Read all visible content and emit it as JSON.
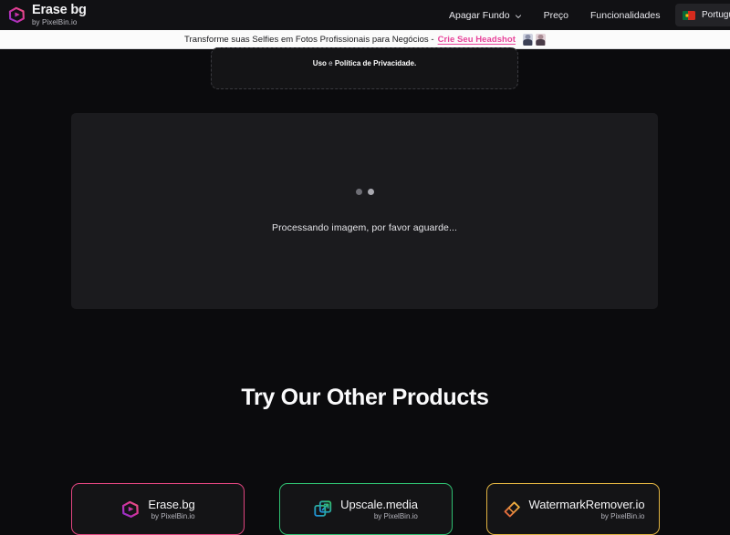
{
  "header": {
    "logo": {
      "title": "Erase bg",
      "subtitle": "by PixelBin.io",
      "icon": "erasebg-logo-icon"
    },
    "nav": [
      {
        "label": "Apagar Fundo",
        "has_dropdown": true,
        "icon": "chevron-down-icon"
      },
      {
        "label": "Preço",
        "has_dropdown": false
      },
      {
        "label": "Funcionalidades",
        "has_dropdown": false
      }
    ],
    "language": {
      "label": "Português",
      "flag": "portugal-flag-icon"
    }
  },
  "promo": {
    "text": "Transforme suas Selfies em Fotos Profissionais para Negócios - ",
    "link": "Crie Seu Headshot",
    "link_color": "#e8439a",
    "avatars": [
      "headshot-thumbnail-1",
      "headshot-thumbnail-2"
    ]
  },
  "upload": {
    "terms_prefix": "Uso",
    "terms_middle": " e ",
    "terms_suffix": "Política de Privacidade."
  },
  "processing": {
    "message": "Processando imagem, por favor aguarde...",
    "spinner": "loading-dots-icon"
  },
  "products": {
    "heading": "Try Our Other Products",
    "cards": [
      {
        "title": "Erase.bg",
        "subtitle": "by PixelBin.io",
        "icon": "erasebg-product-icon",
        "accent": "#e0457f"
      },
      {
        "title": "Upscale.media",
        "subtitle": "by PixelBin.io",
        "icon": "upscale-media-icon",
        "accent": "#2fbf71"
      },
      {
        "title": "WatermarkRemover.io",
        "subtitle": "by PixelBin.io",
        "icon": "watermark-remover-icon",
        "accent": "#e0b341"
      }
    ]
  }
}
